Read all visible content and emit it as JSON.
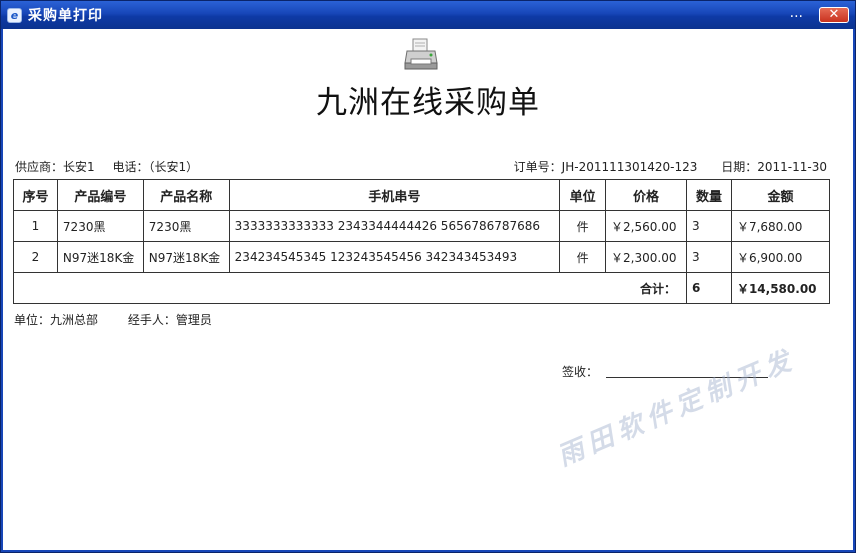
{
  "window": {
    "title": "采购单打印",
    "more_label": "...",
    "close_label": "✕"
  },
  "document": {
    "title": "九洲在线采购单",
    "supplier": "供应商：长安1",
    "phone": "电话：（长安1）",
    "order_no": "订单号：JH-201111301420-123",
    "date": "日期：2011-11-30"
  },
  "table": {
    "headers": [
      "序号",
      "产品编号",
      "产品名称",
      "手机串号",
      "单位",
      "价格",
      "数量",
      "金额"
    ],
    "rows": [
      {
        "index": "1",
        "code": "7230黑",
        "name": "7230黑",
        "serials": "3333333333333 2343344444426 5656786787686",
        "unit": "件",
        "price": "￥2,560.00",
        "qty": "3",
        "amount": "￥7,680.00"
      },
      {
        "index": "2",
        "code": "N97迷18K金",
        "name": "N97迷18K金",
        "serials": "234234545345 123243545456 342343453493",
        "unit": "件",
        "price": "￥2,300.00",
        "qty": "3",
        "amount": "￥6,900.00"
      }
    ],
    "total_label": "合计：",
    "total_qty": "6",
    "total_amount": "￥14,580.00"
  },
  "footer": {
    "unit": "单位：九洲总部",
    "handler": "经手人：管理员",
    "sign_label": "签收："
  },
  "watermark": "雨田软件定制开发",
  "colors": {
    "titlebar": "#1746b8",
    "close_button": "#c8321e"
  },
  "icons": {
    "app": "ie-app-icon",
    "printer": "printer-icon"
  }
}
